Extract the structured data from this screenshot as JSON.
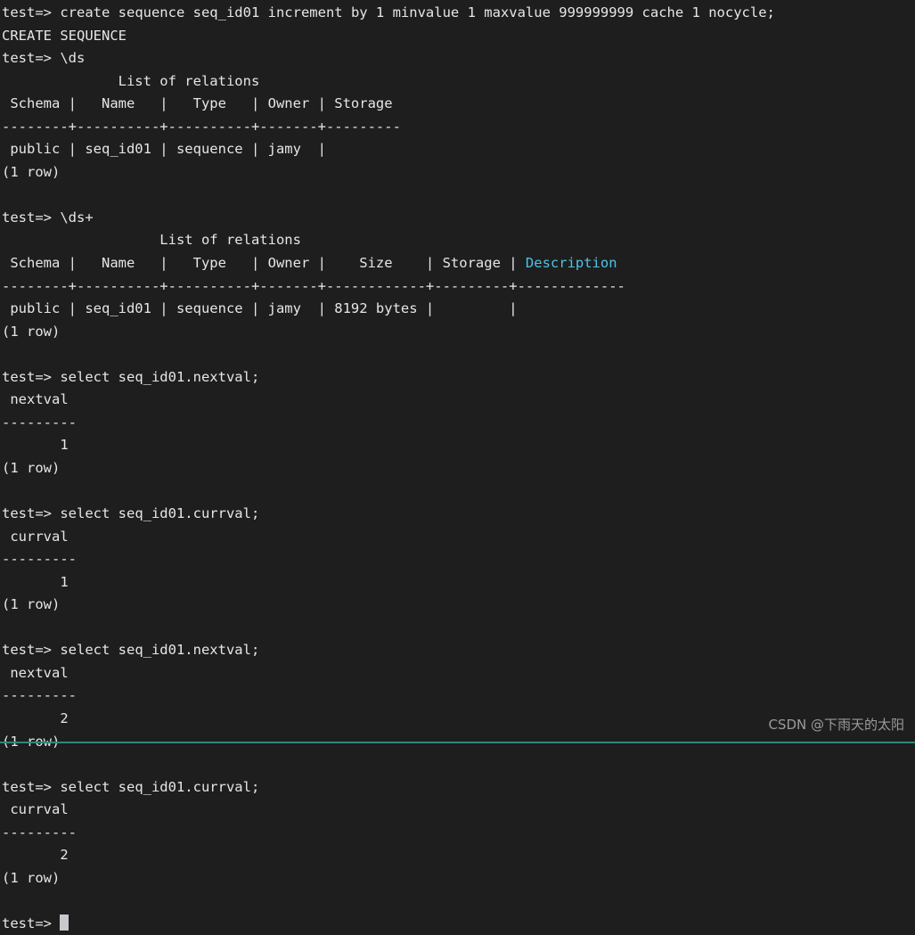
{
  "terminal": {
    "background_color": "#1e1e1e",
    "foreground_color": "#e6e6e6",
    "accent_color": "#4fc3e8",
    "bottom_rule_color": "#2f8a74",
    "prompt": "test=> ",
    "cursor_glyph": "block-cursor",
    "lines": [
      "test=> create sequence seq_id01 increment by 1 minvalue 1 maxvalue 999999999 cache 1 nocycle;",
      "CREATE SEQUENCE",
      "test=> \\ds",
      "              List of relations",
      " Schema |   Name   |   Type   | Owner | Storage ",
      "--------+----------+----------+-------+---------",
      " public | seq_id01 | sequence | jamy  |",
      "(1 row)",
      "",
      "test=> \\ds+",
      "                   List of relations",
      " Schema |   Name   |   Type   | Owner |    Size    | Storage | Description ",
      "--------+----------+----------+-------+------------+---------+-------------",
      " public | seq_id01 | sequence | jamy  | 8192 bytes |         |",
      "(1 row)",
      "",
      "test=> select seq_id01.nextval;",
      " nextval ",
      "---------",
      "       1",
      "(1 row)",
      "",
      "test=> select seq_id01.currval;",
      " currval ",
      "---------",
      "       1",
      "(1 row)",
      "",
      "test=> select seq_id01.nextval;",
      " nextval ",
      "---------",
      "       2",
      "(1 row)",
      "",
      "test=> select seq_id01.currval;",
      " currval ",
      "---------",
      "       2",
      "(1 row)",
      "",
      "test=> "
    ],
    "command_1": {
      "prompt": "test=> ",
      "text": "create sequence seq_id01 increment by 1 minvalue 1 maxvalue 999999999 cache 1 nocycle;",
      "result": "CREATE SEQUENCE"
    },
    "command_2": {
      "prompt": "test=> ",
      "text": "\\ds",
      "table_title": "List of relations",
      "columns": [
        "Schema",
        "Name",
        "Type",
        "Owner",
        "Storage"
      ],
      "rows": [
        [
          "public",
          "seq_id01",
          "sequence",
          "jamy",
          ""
        ]
      ],
      "row_count": "(1 row)"
    },
    "command_3": {
      "prompt": "test=> ",
      "text": "\\ds+",
      "table_title": "List of relations",
      "columns": [
        "Schema",
        "Name",
        "Type",
        "Owner",
        "Size",
        "Storage",
        "Description"
      ],
      "highlighted_column": "Description",
      "rows": [
        [
          "public",
          "seq_id01",
          "sequence",
          "jamy",
          "8192 bytes",
          "",
          ""
        ]
      ],
      "row_count": "(1 row)"
    },
    "command_4": {
      "prompt": "test=> ",
      "text": "select seq_id01.nextval;",
      "column": "nextval",
      "value": "1",
      "row_count": "(1 row)"
    },
    "command_5": {
      "prompt": "test=> ",
      "text": "select seq_id01.currval;",
      "column": "currval",
      "value": "1",
      "row_count": "(1 row)"
    },
    "command_6": {
      "prompt": "test=> ",
      "text": "select seq_id01.nextval;",
      "column": "nextval",
      "value": "2",
      "row_count": "(1 row)"
    },
    "command_7": {
      "prompt": "test=> ",
      "text": "select seq_id01.currval;",
      "column": "currval",
      "value": "2",
      "row_count": "(1 row)"
    },
    "final_prompt": "test=> "
  },
  "watermark": {
    "text": "CSDN @下雨天的太阳"
  },
  "segments": {
    "ds_plus_header_left": " Schema |   Name   |   Type   | Owner |    Size    | Storage | ",
    "ds_plus_header_description": "Description"
  }
}
